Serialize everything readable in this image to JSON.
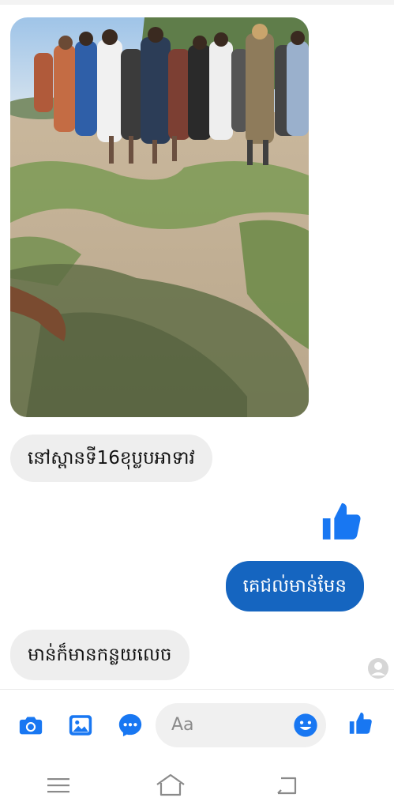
{
  "messages": [
    {
      "text": "នៅស្ពានទី16ខុប្លបអាទាវ"
    },
    {
      "text": "គេជល់មាន់មែន"
    },
    {
      "text": "មាន់ក៏មានកន្លយលេច"
    }
  ],
  "composer": {
    "placeholder": "Aa"
  },
  "colors": {
    "accent": "#1877f2",
    "outgoing_bubble": "#1565c0",
    "incoming_bubble": "#eeeeee"
  },
  "icons": [
    "camera-icon",
    "gallery-icon",
    "chat-icon",
    "emoji-icon",
    "like-icon",
    "menu-icon",
    "home-icon",
    "back-icon",
    "seen-avatar-icon"
  ]
}
